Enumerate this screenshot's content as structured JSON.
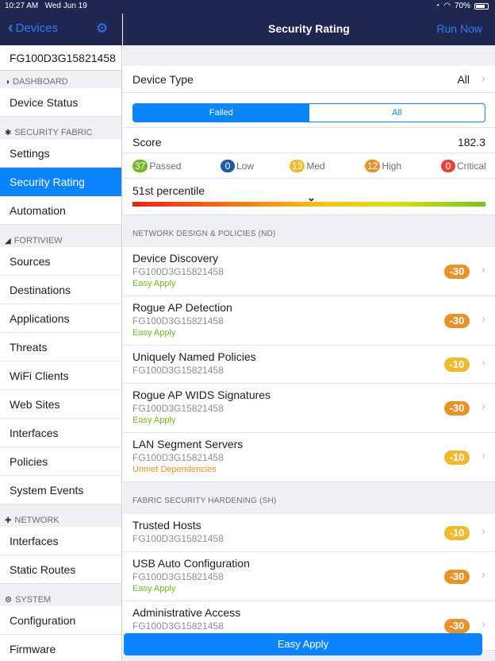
{
  "status": {
    "time": "10:27 AM",
    "date": "Wed Jun 19",
    "battery": "70%"
  },
  "nav": {
    "back_label": "Devices",
    "title": "Security Rating",
    "run_now": "Run Now"
  },
  "sidebar": {
    "device_serial": "FG100D3G15821458",
    "sections": [
      {
        "title": "DASHBOARD",
        "icon": "dashboard-icon",
        "items": [
          "Device Status"
        ]
      },
      {
        "title": "SECURITY FABRIC",
        "icon": "fabric-icon",
        "items": [
          "Settings",
          "Security Rating",
          "Automation"
        ]
      },
      {
        "title": "FORTIVIEW",
        "icon": "fortiview-icon",
        "items": [
          "Sources",
          "Destinations",
          "Applications",
          "Threats",
          "WiFi Clients",
          "Web Sites",
          "Interfaces",
          "Policies",
          "System Events"
        ]
      },
      {
        "title": "NETWORK",
        "icon": "network-icon",
        "items": [
          "Interfaces",
          "Static Routes"
        ]
      },
      {
        "title": "SYSTEM",
        "icon": "system-icon",
        "items": [
          "Configuration",
          "Firmware"
        ]
      }
    ],
    "active_item": "Security Rating"
  },
  "main": {
    "device_type_label": "Device Type",
    "device_type_value": "All",
    "filter": {
      "options": [
        "Failed",
        "All"
      ],
      "selected": "Failed"
    },
    "score_label": "Score",
    "score_value": "182.3",
    "counts": [
      {
        "count": "37",
        "label": "Passed",
        "color": "#72b829"
      },
      {
        "count": "0",
        "label": "Low",
        "color": "#1e5aa8"
      },
      {
        "count": "13",
        "label": "Med",
        "color": "#f0ba2e"
      },
      {
        "count": "12",
        "label": "High",
        "color": "#e8922a"
      },
      {
        "count": "0",
        "label": "Critical",
        "color": "#e0463b"
      }
    ],
    "percentile_label": "51st percentile",
    "percentile_value": 51,
    "section_nd": "NETWORK DESIGN & POLICIES (ND)",
    "nd_items": [
      {
        "title": "Device Discovery",
        "serial": "FG100D3G15821458",
        "tag": "Easy Apply",
        "score": "-30"
      },
      {
        "title": "Rogue AP Detection",
        "serial": "FG100D3G15821458",
        "tag": "Easy Apply",
        "score": "-30"
      },
      {
        "title": "Uniquely Named Policies",
        "serial": "FG100D3G15821458",
        "tag": "",
        "score": "-10"
      },
      {
        "title": "Rogue AP WIDS Signatures",
        "serial": "FG100D3G15821458",
        "tag": "Easy Apply",
        "score": "-30"
      },
      {
        "title": "LAN Segment Servers",
        "serial": "FG100D3G15821458",
        "tag": "Unmet Dependencies",
        "score": "-10"
      }
    ],
    "section_sh": "FABRIC SECURITY HARDENING (SH)",
    "sh_items": [
      {
        "title": "Trusted Hosts",
        "serial": "FG100D3G15821458",
        "tag": "",
        "score": "-10"
      },
      {
        "title": "USB Auto Configuration",
        "serial": "FG100D3G15821458",
        "tag": "Easy Apply",
        "score": "-30"
      },
      {
        "title": "Administrative Access",
        "serial": "FG100D3G15821458",
        "tag": "",
        "score": "-30"
      }
    ],
    "easy_apply_button": "Easy Apply"
  }
}
